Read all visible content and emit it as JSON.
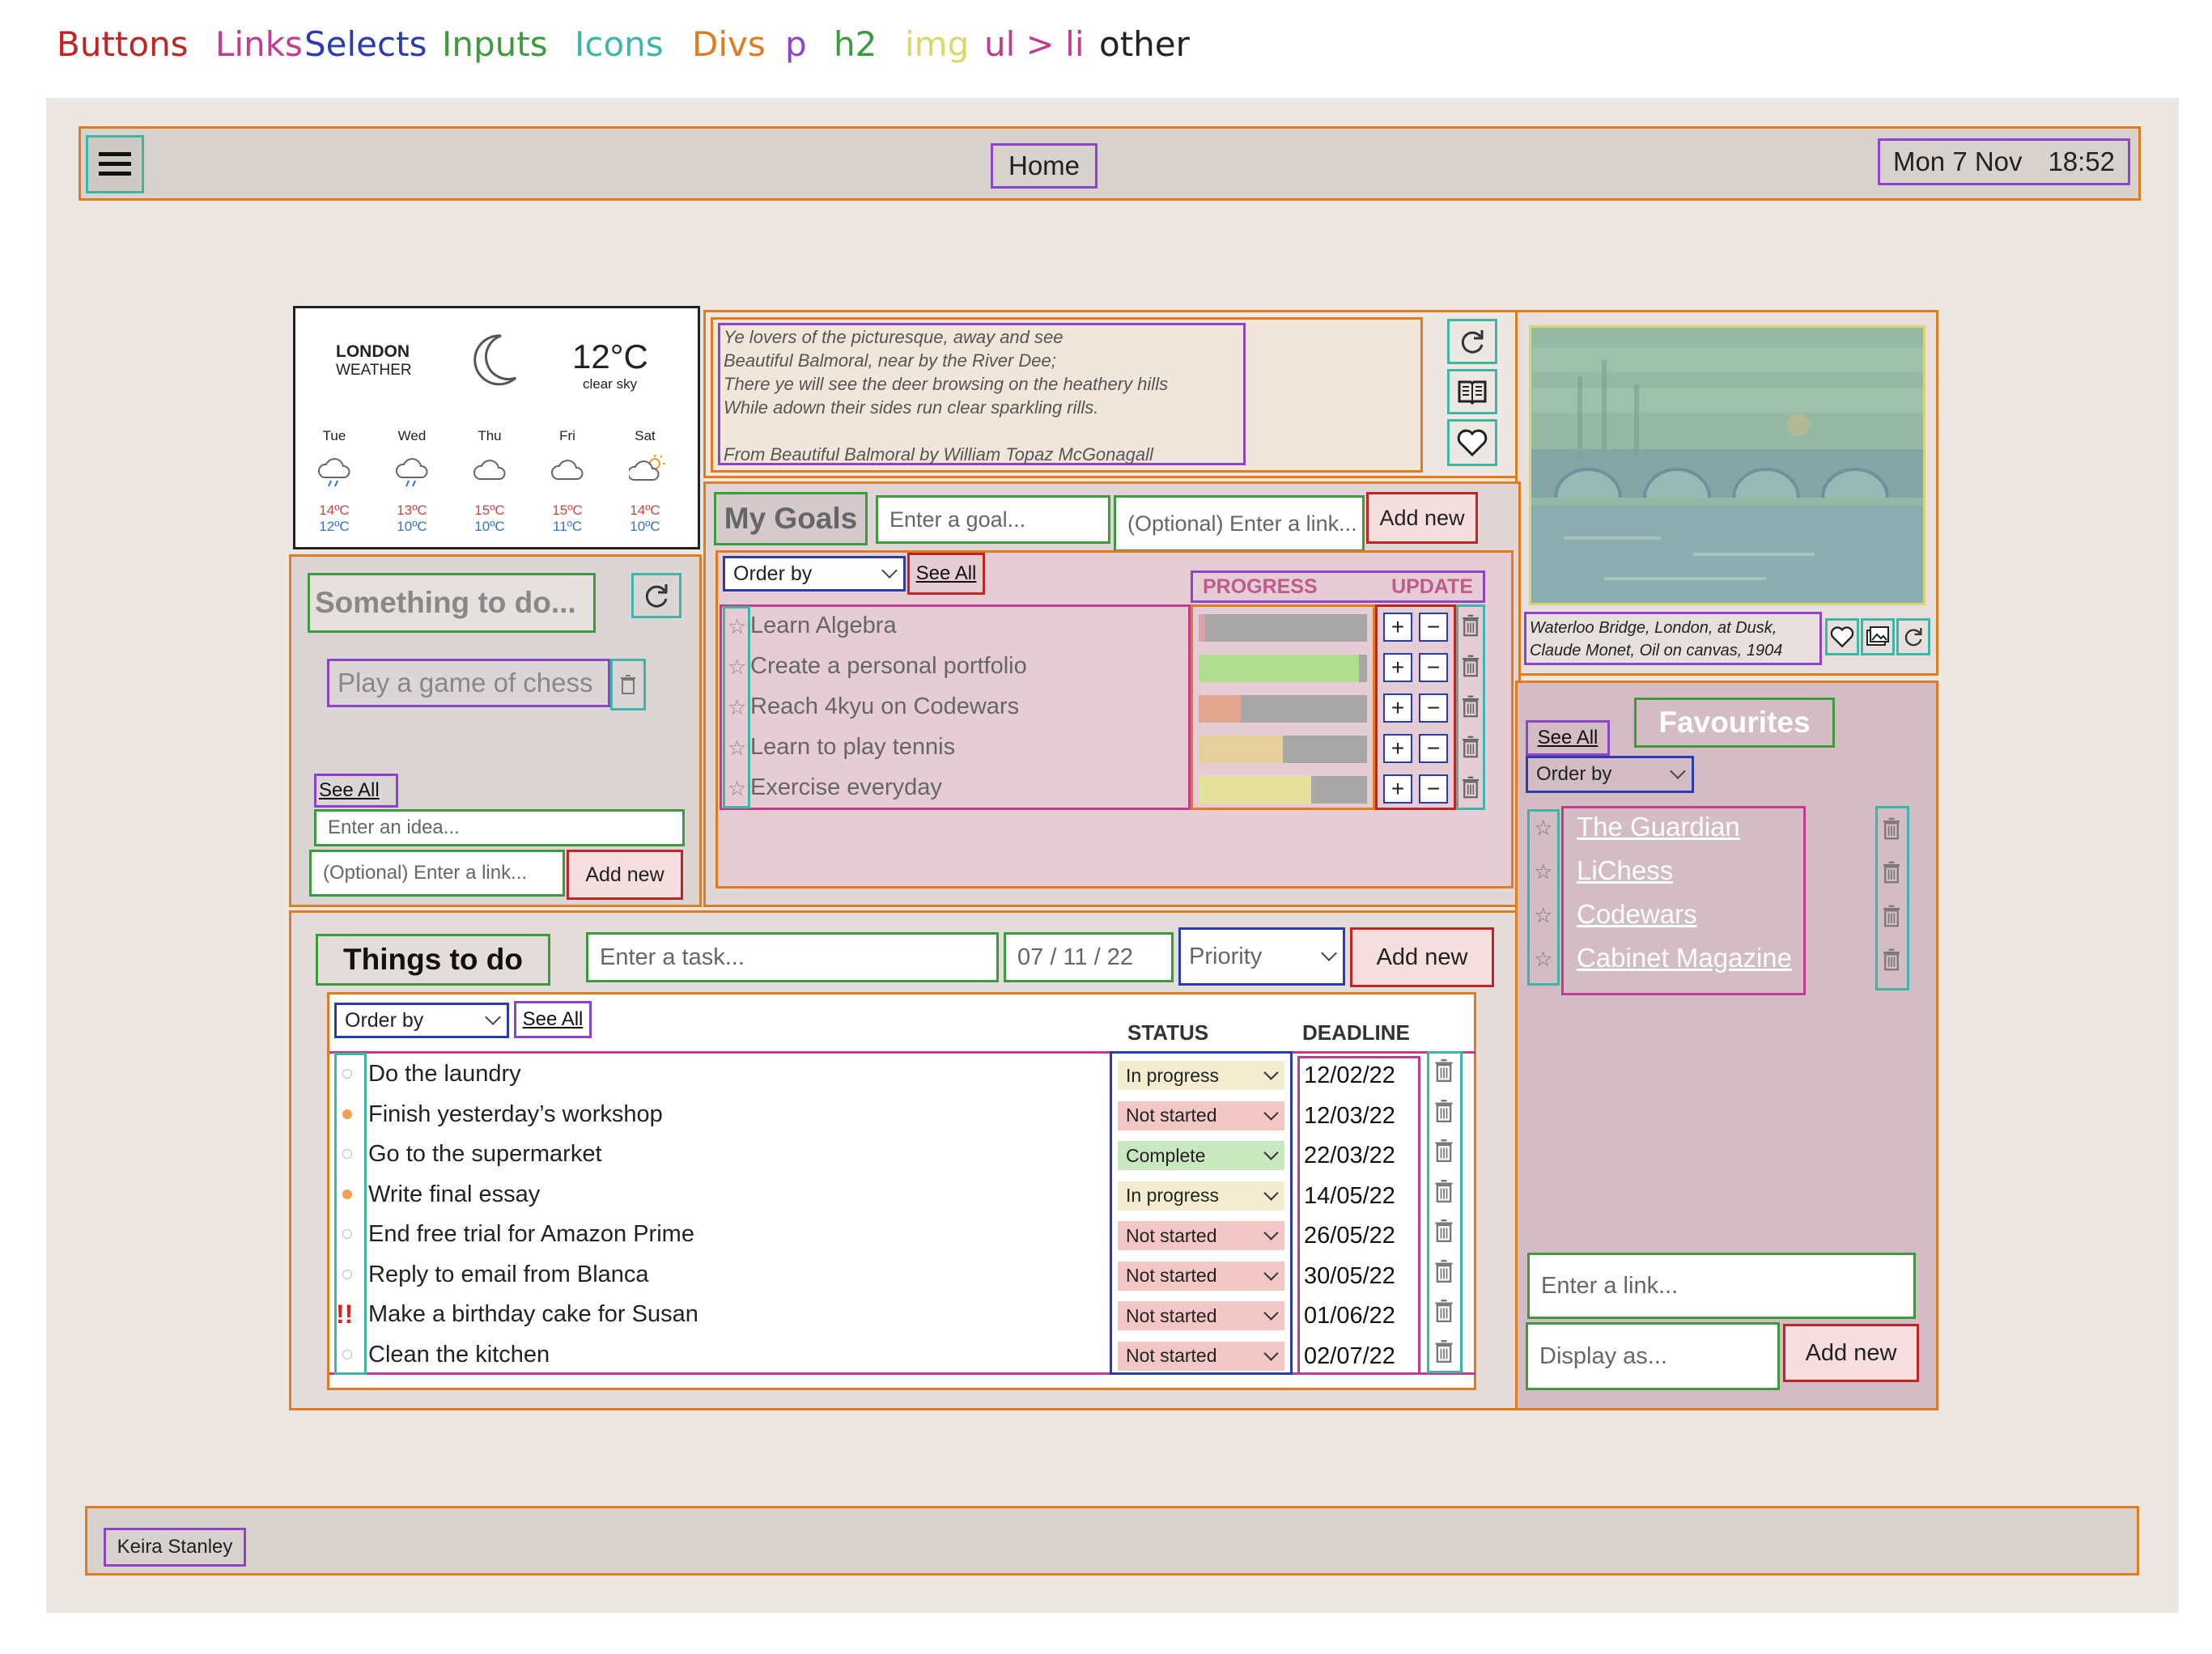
{
  "legend": [
    {
      "label": "Buttons",
      "color": "#c02424"
    },
    {
      "label": "Links",
      "color": "#c03c8e"
    },
    {
      "label": "Selects",
      "color": "#2a3db0"
    },
    {
      "label": "Inputs",
      "color": "#3d9a3d"
    },
    {
      "label": "Icons",
      "color": "#3db6a6"
    },
    {
      "label": "Divs",
      "color": "#e07b20"
    },
    {
      "label": "p",
      "color": "#8e44c9"
    },
    {
      "label": "h2",
      "color": "#3d9a3d"
    },
    {
      "label": "img",
      "color": "#d8d86a"
    },
    {
      "label": "ul > li",
      "color": "#c03c8e"
    },
    {
      "label": "other",
      "color": "#222"
    }
  ],
  "header": {
    "menu_icon": "hamburger-icon",
    "title": "Home",
    "date": "Mon 7 Nov",
    "time": "18:52"
  },
  "weather": {
    "city": "LONDON",
    "subtitle": "WEATHER",
    "temp": "12°C",
    "condition": "clear sky",
    "icon": "moon-icon",
    "days": [
      {
        "day": "Tue",
        "icon": "rain-cloud-icon",
        "high": "14ºC",
        "low": "12ºC"
      },
      {
        "day": "Wed",
        "icon": "rain-cloud-icon",
        "high": "13ºC",
        "low": "10ºC"
      },
      {
        "day": "Thu",
        "icon": "cloud-icon",
        "high": "15ºC",
        "low": "10ºC"
      },
      {
        "day": "Fri",
        "icon": "cloud-icon",
        "high": "15ºC",
        "low": "11ºC"
      },
      {
        "day": "Sat",
        "icon": "sun-cloud-icon",
        "high": "14ºC",
        "low": "10ºC"
      }
    ]
  },
  "poem": {
    "lines": [
      "Ye lovers of the picturesque, away and see",
      "Beautiful Balmoral, near by the River Dee;",
      "There ye will see the deer browsing on the heathery hills",
      "While adown their sides run clear sparkling rills."
    ],
    "source_prefix": "From ",
    "source_title": "Beautiful Balmoral",
    "source_suffix": " by William Topaz McGonagall",
    "icons": [
      "refresh-icon",
      "book-icon",
      "heart-icon"
    ]
  },
  "artwork": {
    "caption_line1": "Waterloo Bridge, London, at Dusk,",
    "caption_line2": "Claude Monet, Oil on canvas, 1904",
    "icons": [
      "heart-icon",
      "gallery-icon",
      "refresh-icon"
    ]
  },
  "something": {
    "title": "Something to do...",
    "idea": "Play a game of chess",
    "see_all": "See All",
    "idea_placeholder": "Enter an idea...",
    "link_placeholder": "(Optional) Enter a link...",
    "add_label": "Add new"
  },
  "goals": {
    "title": "My Goals",
    "goal_placeholder": "Enter a goal...",
    "link_placeholder": "(Optional) Enter a link...",
    "add_label": "Add new",
    "order_by": "Order by",
    "see_all": "See All",
    "progress_header": "PROGRESS",
    "update_header": "UPDATE",
    "items": [
      {
        "label": "Learn Algebra",
        "progress": 0.04,
        "color": "#d8a6a6"
      },
      {
        "label": "Create a personal portfolio",
        "progress": 0.95,
        "color": "#b3de8f"
      },
      {
        "label": "Reach 4kyu on Codewars",
        "progress": 0.25,
        "color": "#e3a690"
      },
      {
        "label": "Learn to play tennis",
        "progress": 0.5,
        "color": "#e5cf9a"
      },
      {
        "label": "Exercise everyday",
        "progress": 0.67,
        "color": "#e5e09a"
      }
    ]
  },
  "todo": {
    "title": "Things to do",
    "task_placeholder": "Enter a task...",
    "date_value": "07 / 11 / 22",
    "priority": "Priority",
    "add_label": "Add new",
    "order_by": "Order by",
    "see_all": "See All",
    "status_header": "STATUS",
    "deadline_header": "DEADLINE",
    "items": [
      {
        "label": "Do the laundry",
        "priority": "none",
        "status": "In progress",
        "status_color": "#f3ecd0",
        "deadline": "12/02/22"
      },
      {
        "label": "Finish yesterday’s workshop",
        "priority": "medium",
        "status": "Not started",
        "status_color": "#f4c7c7",
        "deadline": "12/03/22"
      },
      {
        "label": "Go to the supermarket",
        "priority": "none",
        "status": "Complete",
        "status_color": "#c9e8c0",
        "deadline": "22/03/22"
      },
      {
        "label": "Write final essay",
        "priority": "medium",
        "status": "In progress",
        "status_color": "#f3ecd0",
        "deadline": "14/05/22"
      },
      {
        "label": "End free trial for Amazon Prime",
        "priority": "none",
        "status": "Not started",
        "status_color": "#f4c7c7",
        "deadline": "26/05/22"
      },
      {
        "label": "Reply to email from Blanca",
        "priority": "none",
        "status": "Not started",
        "status_color": "#f4c7c7",
        "deadline": "30/05/22"
      },
      {
        "label": "Make a birthday cake for Susan",
        "priority": "high",
        "status": "Not started",
        "status_color": "#f4c7c7",
        "deadline": "01/06/22"
      },
      {
        "label": "Clean the kitchen",
        "priority": "none",
        "status": "Not started",
        "status_color": "#f4c7c7",
        "deadline": "02/07/22"
      }
    ]
  },
  "favourites": {
    "title": "Favourites",
    "see_all": "See All",
    "order_by": "Order by",
    "links": [
      "The Guardian",
      "LiChess",
      "Codewars",
      "Cabinet Magazine"
    ],
    "link_placeholder": "Enter a link...",
    "display_placeholder": "Display as...",
    "add_label": "Add new"
  },
  "footer": {
    "name": "Keira Stanley"
  }
}
